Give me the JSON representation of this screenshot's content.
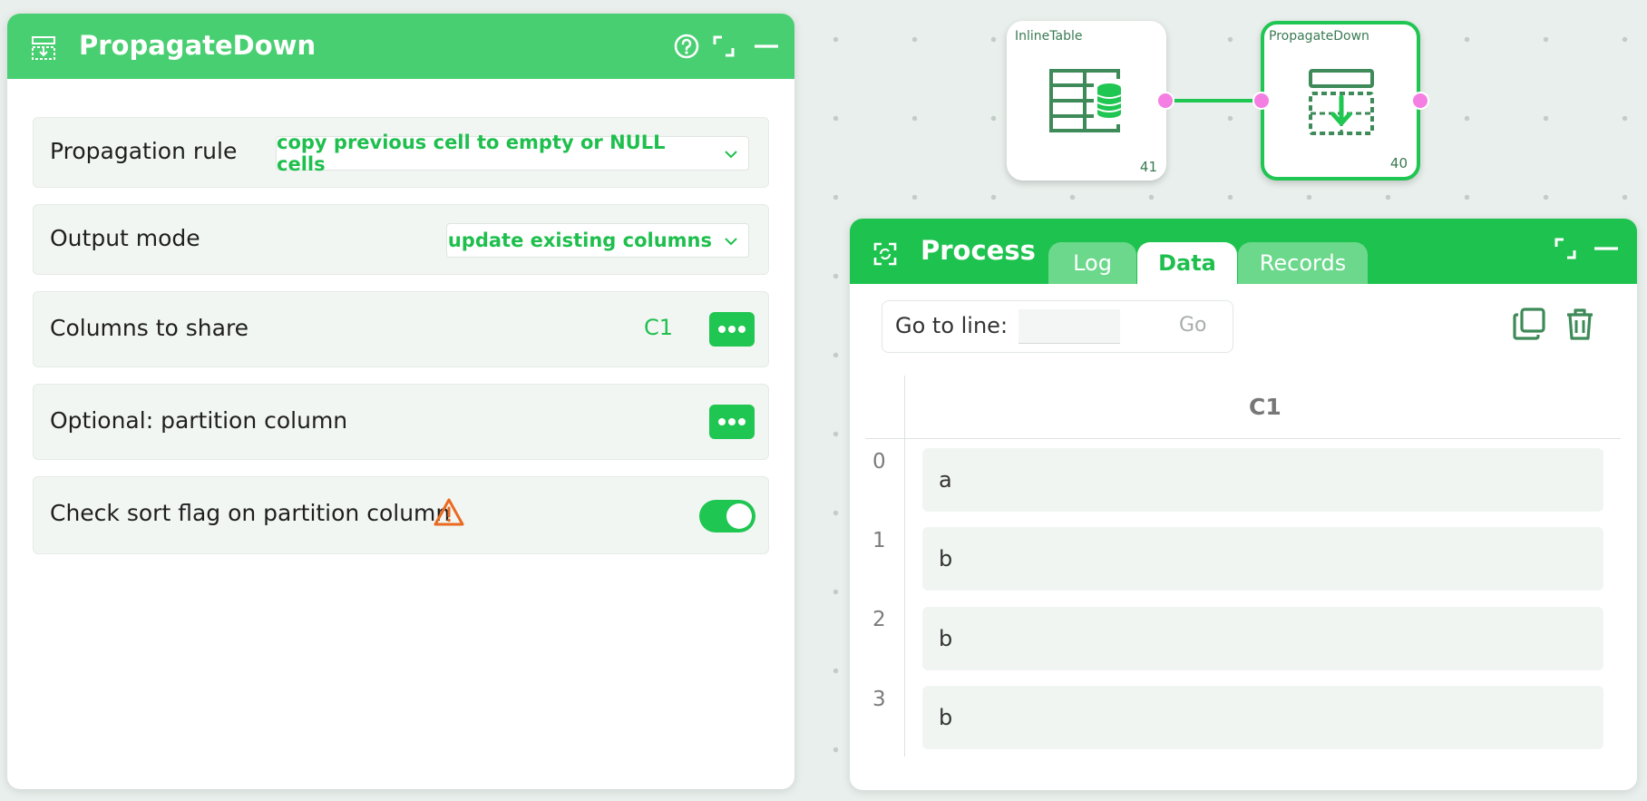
{
  "colors": {
    "brand_green": "#48cf71",
    "accent_green": "#1fc651",
    "port_pink": "#f57ee3",
    "warning_orange": "#ea6a1f"
  },
  "config_panel": {
    "title": "PropagateDown",
    "icons": [
      "propagate-down-icon",
      "help-icon",
      "maximize-icon",
      "minimize-icon"
    ],
    "rows": {
      "propagation_rule": {
        "label": "Propagation rule",
        "value": "copy previous cell to empty or NULL cells"
      },
      "output_mode": {
        "label": "Output mode",
        "value": "update existing columns"
      },
      "columns_to_share": {
        "label": "Columns to share",
        "value": "C1"
      },
      "partition_column": {
        "label": "Optional: partition column"
      },
      "check_sort_flag": {
        "label": "Check sort flag on partition column",
        "enabled": true
      }
    }
  },
  "canvas": {
    "nodes": [
      {
        "name": "InlineTable",
        "id": "41",
        "icon": "inline-table-icon"
      },
      {
        "name": "PropagateDown",
        "id": "40",
        "icon": "propagate-down-icon",
        "selected": true
      }
    ]
  },
  "process_panel": {
    "title": "Process",
    "tabs": [
      {
        "label": "Log",
        "active": false
      },
      {
        "label": "Data",
        "active": true
      },
      {
        "label": "Records",
        "active": false
      }
    ],
    "goto": {
      "label": "Go to line:",
      "value": "",
      "button": "Go"
    },
    "table": {
      "columns": [
        "C1"
      ],
      "rows": [
        {
          "index": "0",
          "C1": "a"
        },
        {
          "index": "1",
          "C1": "b"
        },
        {
          "index": "2",
          "C1": "b"
        },
        {
          "index": "3",
          "C1": "b"
        }
      ]
    }
  }
}
